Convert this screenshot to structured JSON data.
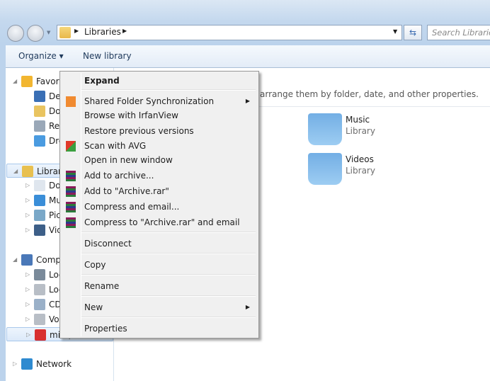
{
  "address": {
    "path": [
      "Libraries"
    ],
    "search_placeholder": "Search Libraries"
  },
  "toolbar": {
    "organize": "Organize ▾",
    "new_library": "New library"
  },
  "nav": {
    "items": [
      {
        "label": "Favorit",
        "icon": "star-icon",
        "expander": "◢",
        "indent": 0,
        "top": 0
      },
      {
        "label": "Desk",
        "icon": "desktop-icon",
        "indent": 1
      },
      {
        "label": "Dow",
        "icon": "downloads-icon",
        "indent": 1
      },
      {
        "label": "Rece",
        "icon": "recent-places-icon",
        "indent": 1
      },
      {
        "label": "Drop",
        "icon": "dropbox-icon",
        "indent": 1
      },
      {
        "label": "Librari",
        "icon": "libraries-icon",
        "expander": "◢",
        "indent": 0,
        "selected": true
      },
      {
        "label": "Docu",
        "icon": "documents-icon",
        "expander": "▷",
        "indent": 1
      },
      {
        "label": "Musi",
        "icon": "music-icon",
        "expander": "▷",
        "indent": 1
      },
      {
        "label": "Pictu",
        "icon": "pictures-icon",
        "expander": "▷",
        "indent": 1
      },
      {
        "label": "Vide",
        "icon": "videos-icon",
        "expander": "▷",
        "indent": 1
      },
      {
        "label": "Compu",
        "icon": "computer-icon",
        "expander": "◢",
        "indent": 0
      },
      {
        "label": "Loca",
        "icon": "system-drive-icon",
        "expander": "▷",
        "indent": 1
      },
      {
        "label": "Loca",
        "icon": "drive-icon",
        "expander": "▷",
        "indent": 1
      },
      {
        "label": "CD D",
        "icon": "cd-drive-icon",
        "expander": "▷",
        "indent": 1
      },
      {
        "label": "Vong",
        "icon": "drive-icon",
        "expander": "▷",
        "indent": 1
      },
      {
        "label": "mis (",
        "icon": "disconnected-network-drive-icon",
        "expander": "▷",
        "indent": 1,
        "hover": true
      },
      {
        "label": "Network",
        "icon": "network-icon",
        "expander": "▷",
        "indent": 0
      }
    ]
  },
  "content": {
    "hint": "arrange them by folder, date, and other properties.",
    "libraries": [
      {
        "name": "Music",
        "type": "Library",
        "icon": "music-library-icon"
      },
      {
        "name": "Videos",
        "type": "Library",
        "icon": "videos-library-icon"
      }
    ]
  },
  "menu": {
    "items": [
      {
        "label": "Expand",
        "bold": true
      },
      {
        "sep": true
      },
      {
        "label": "Shared Folder Synchronization",
        "icon": "sync-icon",
        "submenu": true
      },
      {
        "label": "Browse with IrfanView"
      },
      {
        "label": "Restore previous versions"
      },
      {
        "label": "Scan with AVG",
        "icon": "avg-icon"
      },
      {
        "label": "Open in new window"
      },
      {
        "label": "Add to archive...",
        "icon": "winrar-icon"
      },
      {
        "label": "Add to \"Archive.rar\"",
        "icon": "winrar-icon"
      },
      {
        "label": "Compress and email...",
        "icon": "winrar-icon"
      },
      {
        "label": "Compress to \"Archive.rar\" and email",
        "icon": "winrar-icon"
      },
      {
        "sep": true
      },
      {
        "label": "Disconnect"
      },
      {
        "sep": true
      },
      {
        "label": "Copy"
      },
      {
        "sep": true
      },
      {
        "label": "Rename"
      },
      {
        "sep": true
      },
      {
        "label": "New",
        "submenu": true
      },
      {
        "sep": true
      },
      {
        "label": "Properties"
      }
    ]
  }
}
